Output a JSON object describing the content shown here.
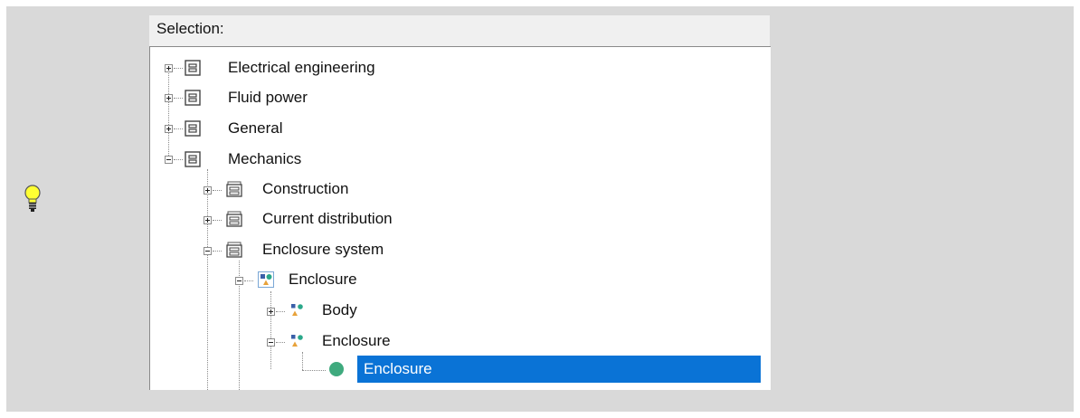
{
  "selection_label": "Selection:",
  "tree": {
    "nodes": [
      {
        "label": "Electrical engineering",
        "state": "collapsed",
        "icon": "category-icon"
      },
      {
        "label": "Fluid power",
        "state": "collapsed",
        "icon": "category-icon"
      },
      {
        "label": "General",
        "state": "collapsed",
        "icon": "category-icon"
      },
      {
        "label": "Mechanics",
        "state": "expanded",
        "icon": "category-icon"
      },
      {
        "label": "Construction",
        "state": "collapsed",
        "icon": "folder-group-icon"
      },
      {
        "label": "Current distribution",
        "state": "collapsed",
        "icon": "folder-group-icon"
      },
      {
        "label": "Enclosure system",
        "state": "expanded",
        "icon": "folder-group-icon"
      },
      {
        "label": "Enclosure",
        "state": "expanded",
        "icon": "shapes-framed-icon"
      },
      {
        "label": "Body",
        "state": "collapsed",
        "icon": "shapes-icon"
      },
      {
        "label": "Enclosure",
        "state": "expanded",
        "icon": "shapes-icon"
      },
      {
        "label": "Enclosure",
        "state": "selected",
        "icon": "green-circle-icon"
      }
    ]
  },
  "colors": {
    "selection": "#0a73d6",
    "background": "#d9d9d9"
  }
}
